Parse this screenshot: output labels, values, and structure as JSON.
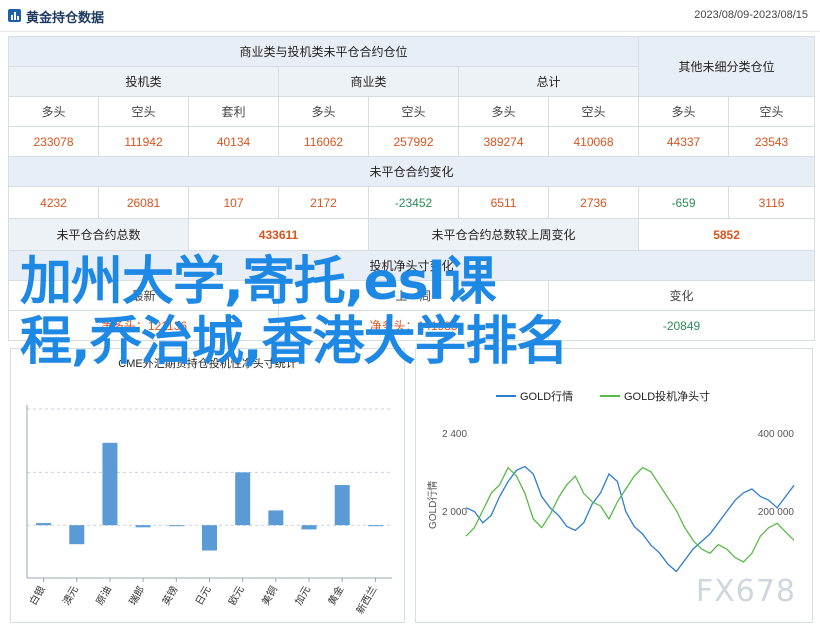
{
  "header": {
    "title": "黄金持仓数据",
    "date_range": "2023/08/09-2023/08/15"
  },
  "table": {
    "nonreportable_title": "商业类与投机类未平仓合约仓位",
    "other_unclassified_title": "其他未细分类仓位",
    "groups": {
      "speculative": "投机类",
      "commercial": "商业类",
      "total": "总计"
    },
    "columns": [
      "多头",
      "空头",
      "套利",
      "多头",
      "空头",
      "多头",
      "空头",
      "多头",
      "空头"
    ],
    "positions": [
      "233078",
      "111942",
      "40134",
      "116062",
      "257992",
      "389274",
      "410068",
      "44337",
      "23543"
    ],
    "change_title": "未平仓合约变化",
    "changes": [
      "4232",
      "26081",
      "107",
      "2172",
      "-23452",
      "6511",
      "2736",
      "-659",
      "3116"
    ],
    "oi_total_label": "未平仓合约总数",
    "oi_total_value": "433611",
    "oi_change_label": "未平仓合约总数较上周变化",
    "oi_change_value": "5852",
    "net_change_title": "投机净头寸变化",
    "net_labels": {
      "col1": "最新",
      "col2": "上一周",
      "col3": "变化"
    },
    "net_values": {
      "col1": "净多头：121136",
      "col2": "净多头：141985",
      "col3": "-20849"
    }
  },
  "colors": {
    "positive": "#d9531e",
    "negative": "#2e8b57",
    "bar": "#5b9bd5",
    "line_price": "#2f7dd1",
    "line_spec": "#59b94a",
    "overlay": "#1e88e5"
  },
  "overlay": {
    "line1": "加州大学,寄托,esl课",
    "line2": "程,乔治城,香港大学排名",
    "brand": "FX678"
  },
  "chart_data": [
    {
      "type": "bar",
      "title": "CME外汇期货持仓投机性净头寸统计",
      "categories": [
        "白银",
        "澳元",
        "原油",
        "瑞郎",
        "英镑",
        "日元",
        "欧元",
        "美铜",
        "加元",
        "黄金",
        "新西兰"
      ],
      "values": [
        1,
        -9,
        39,
        -1,
        0,
        -12,
        25,
        7,
        -2,
        19,
        0
      ],
      "ylim": [
        -25,
        55
      ],
      "grid": true
    },
    {
      "type": "line",
      "legend": [
        "GOLD行情",
        "GOLD投机净头寸"
      ],
      "legend_position": "top",
      "y_left_ticks": [
        "2 400",
        "2 000"
      ],
      "y_right_ticks": [
        "400 000",
        "200 000"
      ],
      "ylabel_left": "GOLD行情",
      "series": [
        {
          "name": "GOLD行情",
          "values": [
            1995,
            1990,
            1975,
            1985,
            2010,
            2030,
            2045,
            2050,
            2040,
            2010,
            1995,
            1985,
            1970,
            1965,
            1975,
            2000,
            2015,
            2040,
            2030,
            1990,
            1970,
            1960,
            1945,
            1935,
            1920,
            1910,
            1925,
            1940,
            1950,
            1960,
            1975,
            1990,
            2005,
            2015,
            2020,
            2010,
            2005,
            1995,
            2010,
            2025
          ]
        },
        {
          "name": "GOLD投机净头寸",
          "values": [
            250,
            260,
            280,
            300,
            310,
            330,
            320,
            300,
            270,
            260,
            275,
            295,
            310,
            320,
            300,
            290,
            285,
            270,
            290,
            305,
            320,
            330,
            325,
            310,
            295,
            280,
            260,
            245,
            235,
            230,
            240,
            235,
            225,
            220,
            230,
            250,
            260,
            265,
            255,
            245
          ]
        }
      ]
    }
  ]
}
